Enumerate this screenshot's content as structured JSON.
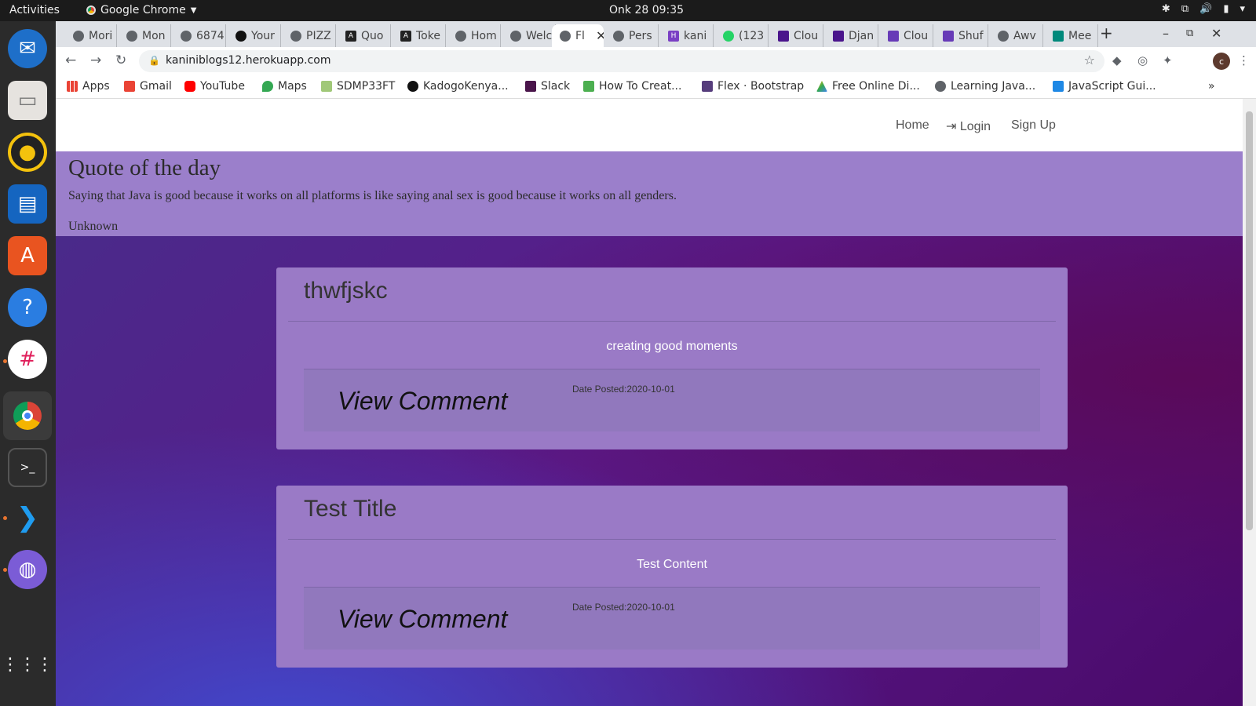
{
  "system": {
    "activities": "Activities",
    "app_menu": "Google Chrome",
    "clock": "Onk 28  09:35"
  },
  "tabs": [
    {
      "label": "Mori"
    },
    {
      "label": "Mon"
    },
    {
      "label": "6874"
    },
    {
      "label": "Your"
    },
    {
      "label": "PIZZ"
    },
    {
      "label": "Quo"
    },
    {
      "label": "Toke"
    },
    {
      "label": "Hom"
    },
    {
      "label": "Welc"
    },
    {
      "label": "Fl",
      "active": true
    },
    {
      "label": "Pers"
    },
    {
      "label": "kani"
    },
    {
      "label": "(123"
    },
    {
      "label": "Clou"
    },
    {
      "label": "Djan"
    },
    {
      "label": "Clou"
    },
    {
      "label": "Shuf"
    },
    {
      "label": "Awv"
    },
    {
      "label": "Mee"
    }
  ],
  "address_bar": {
    "url": "kaniniblogs12.herokuapp.com"
  },
  "bookmarks": [
    {
      "label": "Apps"
    },
    {
      "label": "Gmail"
    },
    {
      "label": "YouTube"
    },
    {
      "label": "Maps"
    },
    {
      "label": "SDMP33FT"
    },
    {
      "label": "KadogoKenya..."
    },
    {
      "label": "Slack"
    },
    {
      "label": "How To Creat..."
    },
    {
      "label": "Flex · Bootstrap"
    },
    {
      "label": "Free Online Di..."
    },
    {
      "label": "Learning Java..."
    },
    {
      "label": "JavaScript Gui..."
    }
  ],
  "profile_initial": "c",
  "site": {
    "nav": {
      "home": "Home",
      "login": "Login",
      "signup": "Sign Up"
    },
    "quote": {
      "heading": "Quote of the day",
      "text": "Saying that Java is good because it works on all platforms is like saying anal sex is good because it works on all genders.",
      "author": "Unknown"
    },
    "posts": [
      {
        "title": "thwfjskc",
        "content": "creating good moments",
        "view_comment": "View Comment",
        "date": "Date Posted:2020-10-01"
      },
      {
        "title": "Test Title",
        "content": "Test Content",
        "view_comment": "View Comment",
        "date": "Date Posted:2020-10-01"
      }
    ]
  },
  "colors": {
    "quote_bg": "#9b7fcb",
    "card_bg": "#9a7ac6",
    "card_footer_bg": "#9178bd",
    "page_bg": "#5a1a8a"
  }
}
